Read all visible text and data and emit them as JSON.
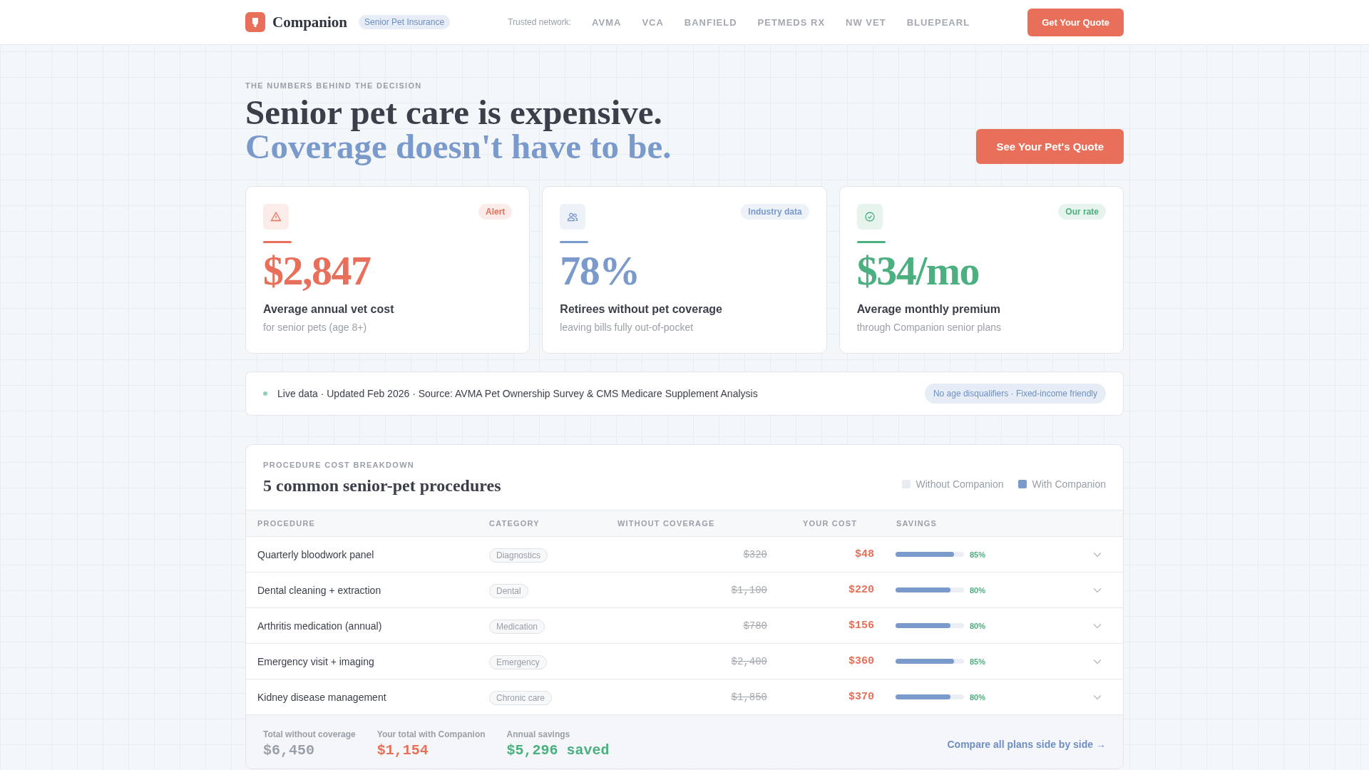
{
  "header": {
    "brand": "Companion",
    "brand_tag": "Senior Pet Insurance",
    "network_label": "Trusted network:",
    "network": [
      "AVMA",
      "VCA",
      "BANFIELD",
      "PETMEDS RX",
      "NW VET",
      "BLUEPEARL"
    ],
    "cta": "Get Your Quote"
  },
  "hero": {
    "eyebrow": "THE NUMBERS BEHIND THE DECISION",
    "title_line_1": "Senior pet care is expensive.",
    "title_line_2": "Coverage doesn't have to be.",
    "cta": "See Your Pet's Quote"
  },
  "cards": [
    {
      "kind": "alert",
      "badge": "Alert",
      "value": "$2,847",
      "label": "Average annual vet cost",
      "sublabel": "for senior pets (age 8+)",
      "color": "#e8705a"
    },
    {
      "kind": "people",
      "badge": "Industry data",
      "value": "78%",
      "label": "Retirees without pet coverage",
      "sublabel": "leaving bills fully out-of-pocket",
      "color": "#7b9acc"
    },
    {
      "kind": "check",
      "badge": "Our rate",
      "value": "$34/mo",
      "label": "Average monthly premium",
      "sublabel": "through Companion senior plans",
      "color": "#4caf80"
    }
  ],
  "live_bar": {
    "text": "Live data · Updated Feb 2026 · Source: AVMA Pet Ownership Survey & CMS Medicare Supplement Analysis",
    "pill": "No age disqualifiers · Fixed-income friendly"
  },
  "table": {
    "eyebrow": "PROCEDURE COST BREAKDOWN",
    "title": "5 common senior-pet procedures",
    "legend": [
      {
        "label": "Without Companion",
        "color": "#e8ebef"
      },
      {
        "label": "With Companion",
        "color": "#7b9acc"
      }
    ],
    "columns": [
      "PROCEDURE",
      "CATEGORY",
      "WITHOUT COVERAGE",
      "YOUR COST",
      "SAVINGS"
    ],
    "rows": [
      {
        "procedure": "Quarterly bloodwork panel",
        "category": "Diagnostics",
        "without": "$320",
        "your_cost": "$48",
        "level": 0.85,
        "savings": "85%"
      },
      {
        "procedure": "Dental cleaning + extraction",
        "category": "Dental",
        "without": "$1,100",
        "your_cost": "$220",
        "level": 0.8,
        "savings": "80%"
      },
      {
        "procedure": "Arthritis medication (annual)",
        "category": "Medication",
        "without": "$780",
        "your_cost": "$156",
        "level": 0.8,
        "savings": "80%"
      },
      {
        "procedure": "Emergency visit + imaging",
        "category": "Emergency",
        "without": "$2,400",
        "your_cost": "$360",
        "level": 0.85,
        "savings": "85%"
      },
      {
        "procedure": "Kidney disease management",
        "category": "Chronic care",
        "without": "$1,850",
        "your_cost": "$370",
        "level": 0.8,
        "savings": "80%"
      }
    ],
    "totals": [
      {
        "kind": "without",
        "label": "Total without coverage",
        "value": "$6,450"
      },
      {
        "kind": "with",
        "label": "Your total with Companion",
        "value": "$1,154"
      },
      {
        "kind": "savings",
        "label": "Annual savings",
        "value": "$5,296 saved"
      }
    ],
    "compare_link": "Compare all plans side by side →"
  }
}
